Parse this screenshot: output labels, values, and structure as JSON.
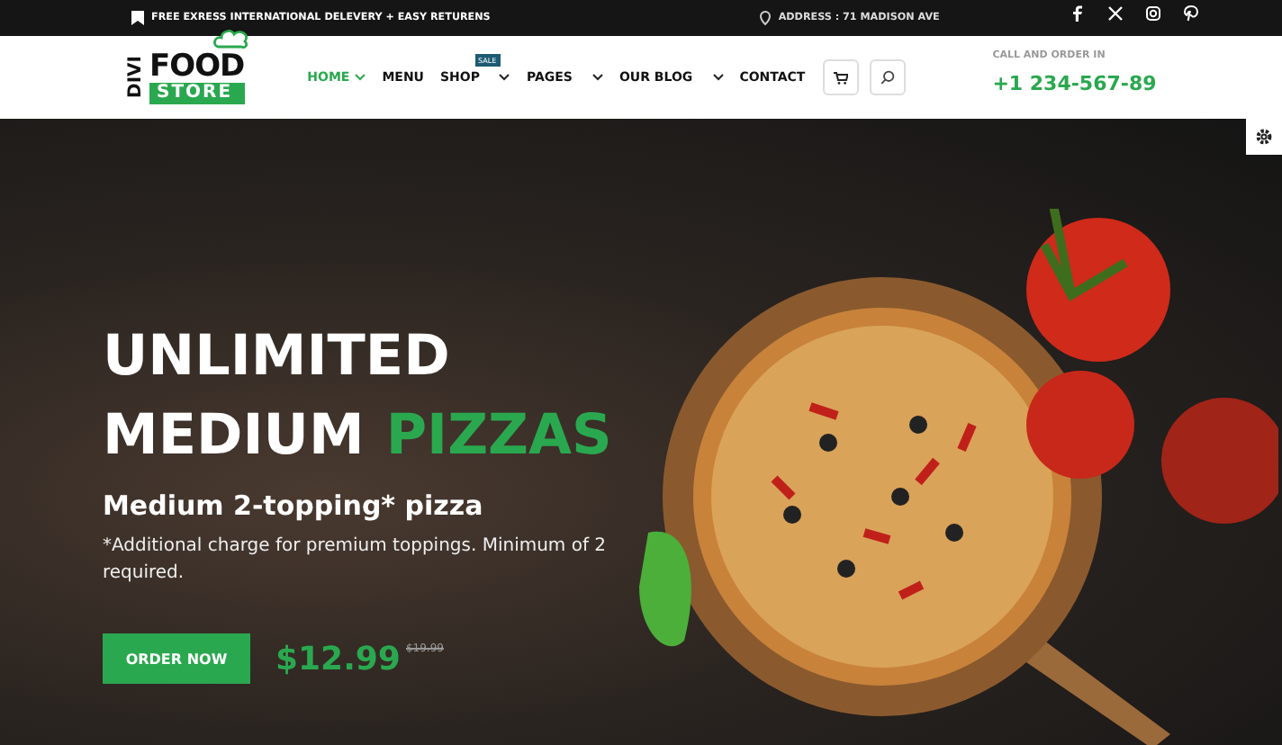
{
  "top_bar": {
    "promo": "FREE EXRESS INTERNATIONAL DELEVERY + EASY RETURENS",
    "address": "ADDRESS : 71 MADISON AVE",
    "social": [
      {
        "kind": "facebook"
      },
      {
        "kind": "x"
      },
      {
        "kind": "instagram"
      },
      {
        "kind": "pinterest"
      }
    ]
  },
  "logo": {
    "side": "DIVI",
    "top": "FOOD",
    "bottom": "STORE"
  },
  "nav": [
    {
      "label": "HOME",
      "selected": true,
      "dropdown": true
    },
    {
      "label": "MENU",
      "selected": false,
      "dropdown": false
    },
    {
      "label": "SHOP",
      "selected": false,
      "dropdown": true,
      "badge": "SALE"
    },
    {
      "label": "PAGES",
      "selected": false,
      "dropdown": true
    },
    {
      "label": "OUR BLOG",
      "selected": false,
      "dropdown": true
    },
    {
      "label": "CONTACT",
      "selected": false,
      "dropdown": false
    }
  ],
  "contact": {
    "label": "CALL AND ORDER IN",
    "phone": "+1 234-567-89"
  },
  "hero": {
    "title_line_1": "UNLIMITED",
    "title_line_2": "MEDIUM",
    "title_highlight": "PIZZAS",
    "subtitle": "Medium 2-topping* pizza",
    "note": "*Additional charge for premium toppings. Minimum of 2 required.",
    "button": "ORDER NOW",
    "price": "$12.99",
    "old_price": "$19.99"
  }
}
